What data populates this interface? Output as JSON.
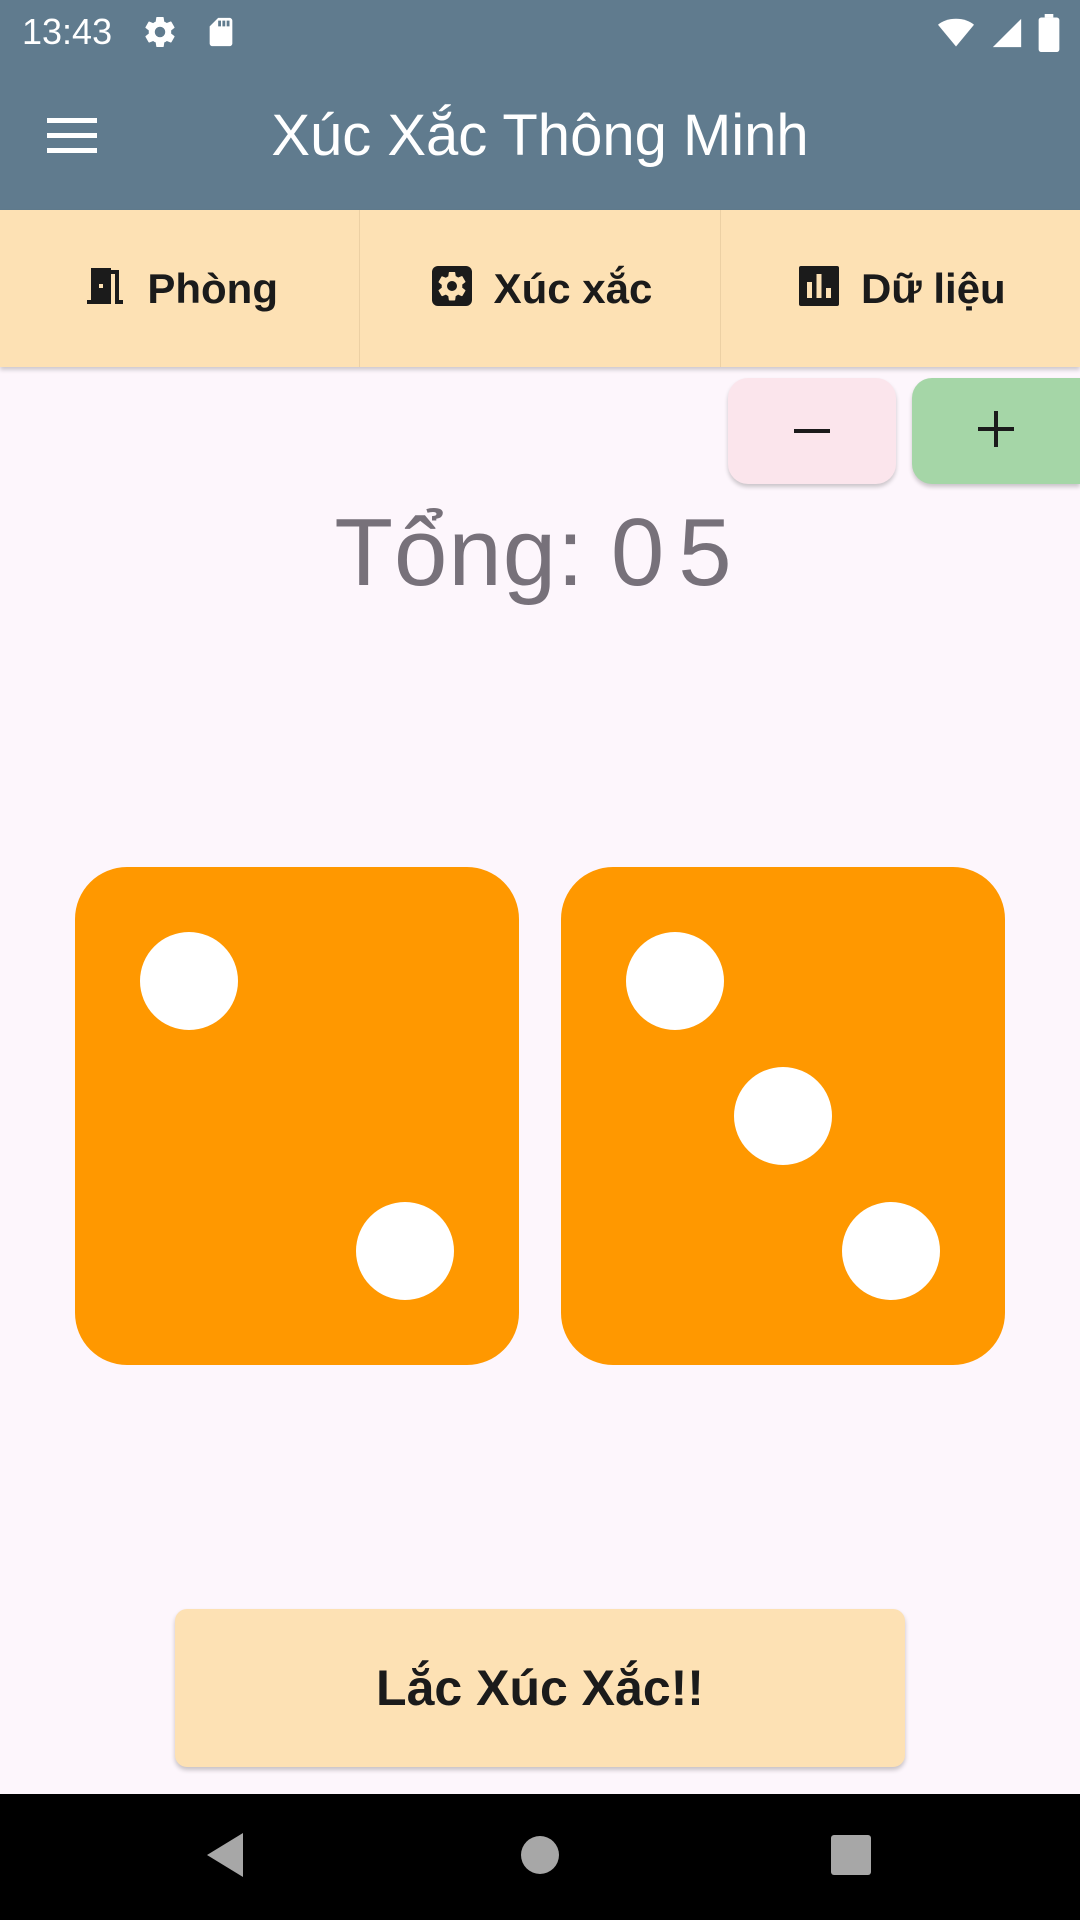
{
  "status_bar": {
    "time": "13:43",
    "left_icons": [
      "gear-icon",
      "sd-card-icon"
    ],
    "right_icons": [
      "wifi-icon",
      "signal-icon",
      "battery-icon"
    ]
  },
  "app_bar": {
    "title": "Xúc Xắc Thông Minh",
    "menu_icon": "hamburger-menu-icon"
  },
  "tabs": [
    {
      "label": "Phòng",
      "icon": "door-icon"
    },
    {
      "label": "Xúc xắc",
      "icon": "dice-settings-icon"
    },
    {
      "label": "Dữ liệu",
      "icon": "bar-chart-icon"
    }
  ],
  "stepper": {
    "minus_label": "−",
    "plus_label": "+"
  },
  "total": {
    "label": "Tổng:",
    "value": "05"
  },
  "dice": [
    {
      "value": 2
    },
    {
      "value": 3
    }
  ],
  "roll_button": {
    "label": "Lắc Xúc Xắc!!"
  },
  "nav_bar": {
    "icons": [
      "back-icon",
      "home-icon",
      "recents-icon"
    ]
  },
  "colors": {
    "app_bar": "#607b8e",
    "tab_bar": "#fde1b4",
    "background": "#fdf6fc",
    "die": "#ff9800",
    "pip": "#ffffff",
    "minus_button": "#fbe5ec",
    "plus_button": "#a5d6a7",
    "total_text": "#77717a"
  }
}
